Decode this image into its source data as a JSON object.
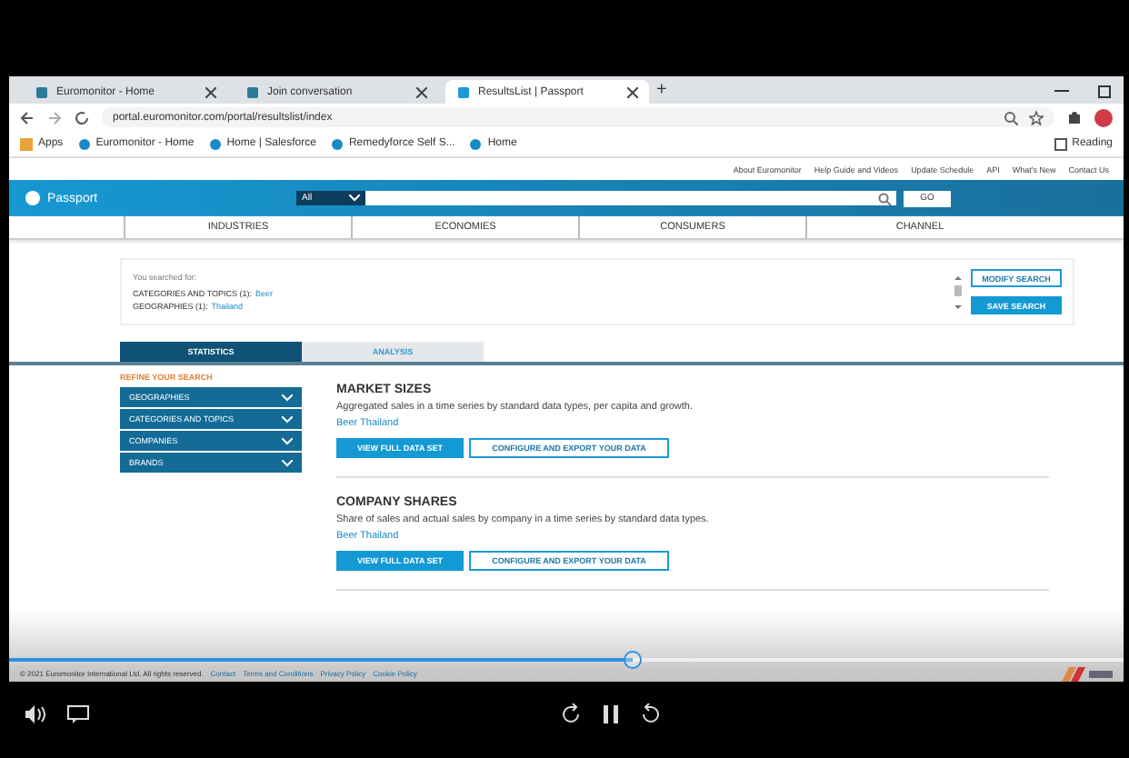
{
  "browser": {
    "tabs": [
      {
        "label": "Euromonitor - Home",
        "selected": false
      },
      {
        "label": "Join conversation",
        "selected": false
      },
      {
        "label": "ResultsList | Passport",
        "selected": true
      }
    ],
    "new_tab": "+",
    "address": "portal.euromonitor.com/portal/resultslist/index",
    "bookmarks": [
      "Apps",
      "Euromonitor - Home",
      "Home | Salesforce",
      "Remedyforce Self S...",
      "Home"
    ],
    "reading_list": "Reading"
  },
  "site": {
    "top_links": [
      "About Euromonitor",
      "Help Guide and Videos",
      "Update Schedule",
      "API",
      "What's New",
      "Contact Us"
    ],
    "logo": "Passport",
    "search_scope": "All",
    "search_button": "GO",
    "nav": [
      "INDUSTRIES",
      "ECONOMIES",
      "CONSUMERS",
      "CHANNEL"
    ],
    "search_summary": {
      "heading": "You searched for:",
      "lines": [
        {
          "label": "CATEGORIES AND TOPICS (1):",
          "value": "Beer"
        },
        {
          "label": "GEOGRAPHIES (1):",
          "value": "Thailand"
        }
      ],
      "modify": "MODIFY SEARCH",
      "save": "SAVE SEARCH"
    },
    "result_tabs": [
      {
        "label": "STATISTICS",
        "selected": true
      },
      {
        "label": "ANALYSIS",
        "selected": false
      }
    ],
    "refine_title": "REFINE YOUR SEARCH",
    "filters": [
      {
        "label": "GEOGRAPHIES",
        "expanded": false
      },
      {
        "label": "CATEGORIES AND TOPICS",
        "expanded": false
      },
      {
        "label": "COMPANIES",
        "expanded": false
      },
      {
        "label": "BRANDS",
        "expanded": false
      }
    ],
    "results": [
      {
        "title": "MARKET SIZES",
        "description": "Aggregated sales in a time series by standard data types, per capita and growth.",
        "link": "Beer Thailand",
        "primary": "VIEW FULL DATA SET",
        "secondary": "CONFIGURE AND EXPORT YOUR DATA"
      },
      {
        "title": "COMPANY SHARES",
        "description": "Share of sales and actual sales by company in a time series by standard data types.",
        "link": "Beer Thailand",
        "primary": "VIEW FULL DATA SET",
        "secondary": "CONFIGURE AND EXPORT YOUR DATA"
      }
    ],
    "footer": [
      "© 2021 Euromonitor International Ltd. All rights reserved.",
      "Contact",
      "Terms and Conditions",
      "Privacy Policy",
      "Cookie Policy"
    ]
  },
  "player": {
    "progress": {
      "level": 0.56
    }
  }
}
